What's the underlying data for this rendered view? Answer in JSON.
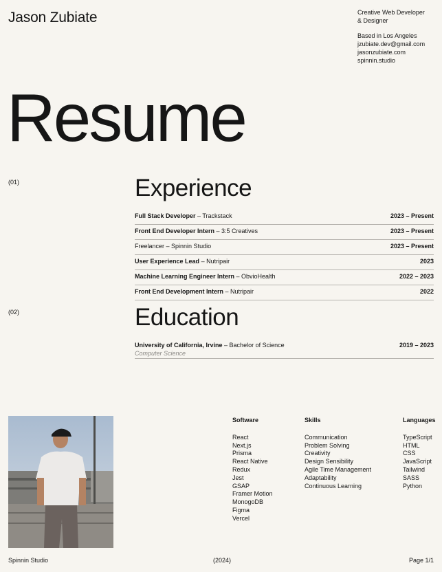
{
  "header": {
    "name": "Jason Zubiate",
    "contact": {
      "title_line1": "Creative Web Developer",
      "title_line2": "& Designer",
      "location": "Based in Los Angeles",
      "email": "jzubiate.dev@gmail.com",
      "website": "jasonzubiate.com",
      "studio": "spinnin.studio"
    }
  },
  "hero": "Resume",
  "experience": {
    "number": "(01)",
    "title": "Experience",
    "items": [
      {
        "role": "Full Stack Developer",
        "company": " – Trackstack",
        "dates": "2023 – Present"
      },
      {
        "role": "Front End Developer Intern",
        "company": " – 3:5 Creatives",
        "dates": "2023 – Present"
      },
      {
        "role": "Freelancer",
        "company": " – Spinnin Studio",
        "dates": "2023 – Present"
      },
      {
        "role": "User Experience Lead",
        "company": " – Nutripair",
        "dates": "2023"
      },
      {
        "role": "Machine Learning Engineer Intern",
        "company": " – ObvioHealth",
        "dates": "2022 – 2023"
      },
      {
        "role": "Front End Development Intern",
        "company": " – Nutripair",
        "dates": "2022"
      }
    ]
  },
  "education": {
    "number": "(02)",
    "title": "Education",
    "school": "University of California, Irvine",
    "degree": " – Bachelor of Science",
    "major": "Computer Science",
    "dates": "2019 – 2023"
  },
  "software": {
    "heading": "Software",
    "items": [
      "React",
      "Next.js",
      "Prisma",
      "React Native",
      "Redux",
      "Jest",
      "GSAP",
      "Framer Motion",
      "MonogoDB",
      "Figma",
      "Vercel"
    ]
  },
  "skills": {
    "heading": "Skills",
    "items": [
      "Communication",
      "Problem Solving",
      "Creativity",
      "Design Sensibility",
      "Agile Time Management",
      "Adaptability",
      "Continuous Learning"
    ]
  },
  "languages": {
    "heading": "Languages",
    "items": [
      "TypeScript",
      "HTML",
      "CSS",
      "JavaScript",
      "Tailwind",
      "SASS",
      "Python"
    ]
  },
  "footer": {
    "left": "Spinnin Studio",
    "center": "(2024)",
    "right": "Page 1/1"
  }
}
